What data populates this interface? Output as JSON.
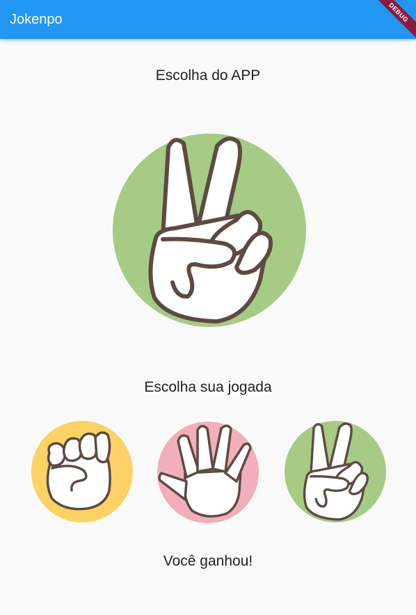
{
  "app_bar": {
    "title": "Jokenpo",
    "debug_label": "DEBUG"
  },
  "app_choice": {
    "title": "Escolha do APP",
    "current": "scissors",
    "icon": "scissors-hand-icon"
  },
  "user_choice": {
    "title": "Escolha sua jogada",
    "options": [
      {
        "id": "rock",
        "icon": "rock-hand-icon",
        "color": "#fcd265"
      },
      {
        "id": "paper",
        "icon": "paper-hand-icon",
        "color": "#f2aebb"
      },
      {
        "id": "scissors",
        "icon": "scissors-hand-icon",
        "color": "#a5cb85"
      }
    ]
  },
  "result": {
    "text": "Você ganhou!"
  },
  "colors": {
    "app_bar": "#2196f3",
    "background": "#fafafa",
    "outline": "#5d4a42"
  }
}
